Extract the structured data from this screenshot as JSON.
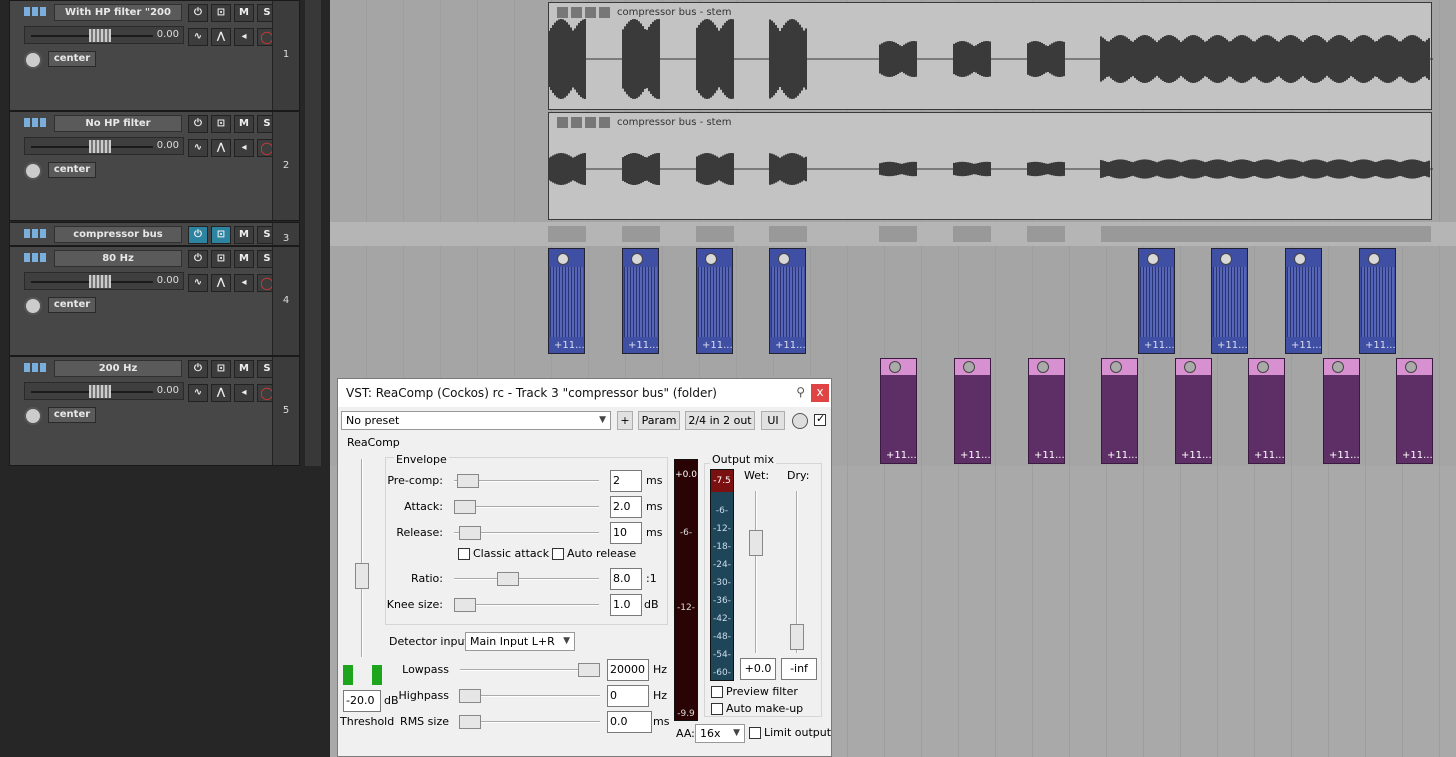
{
  "tracks": [
    {
      "number": "1",
      "name": "With HP filter \"200",
      "volume": "0.00",
      "pan": "center",
      "lit": false
    },
    {
      "number": "2",
      "name": "No HP filter",
      "volume": "0.00",
      "pan": "center",
      "lit": false
    },
    {
      "number": "3",
      "name": "compressor bus",
      "lit": true
    },
    {
      "number": "4",
      "name": "80 Hz",
      "volume": "0.00",
      "pan": "center",
      "lit": false
    },
    {
      "number": "5",
      "name": "200 Hz",
      "volume": "0.00",
      "pan": "center",
      "lit": false
    }
  ],
  "buttons": {
    "mute": "M",
    "solo": "S"
  },
  "items": {
    "stem_title": "compressor bus - stem",
    "block_label": "+11..."
  },
  "fx": {
    "title": "VST: ReaComp (Cockos) rc - Track 3 \"compressor bus\" (folder)",
    "close": "x",
    "preset": "No preset",
    "plus": "+",
    "param": "Param",
    "io": "2/4 in 2 out",
    "ui": "UI",
    "plugin_name": "ReaComp",
    "envelope_label": "Envelope",
    "precomp": {
      "label": "Pre-comp:",
      "value": "2",
      "unit": "ms",
      "slider": 0.05
    },
    "attack": {
      "label": "Attack:",
      "value": "2.0",
      "unit": "ms",
      "slider": 0.03
    },
    "release": {
      "label": "Release:",
      "value": "10",
      "unit": "ms",
      "slider": 0.07
    },
    "classic_attack": "Classic attack",
    "auto_release": "Auto release",
    "ratio": {
      "label": "Ratio:",
      "value": "8.0",
      "unit": ":1",
      "slider": 0.36
    },
    "knee": {
      "label": "Knee size:",
      "value": "1.0",
      "unit": "dB",
      "slider": 0.03
    },
    "detector": {
      "label": "Detector input:",
      "value": "Main Input L+R"
    },
    "lowpass": {
      "label": "Lowpass",
      "value": "20000",
      "unit": "Hz",
      "slider": 0.97
    },
    "highpass": {
      "label": "Highpass",
      "value": "0",
      "unit": "Hz",
      "slider": 0.02
    },
    "rms": {
      "label": "RMS size",
      "value": "0.0",
      "unit": "ms",
      "slider": 0.02
    },
    "threshold": {
      "value": "-20.0",
      "unit": "dB",
      "label": "Threshold",
      "slider": 0.6
    },
    "input_meter": {
      "ticks": [
        "+0.0",
        "-6-",
        "-12-",
        "-9.9"
      ]
    },
    "output_mix": "Output mix",
    "wet": {
      "label": "Wet:",
      "value": "+0.0",
      "slider": 0.3
    },
    "dry": {
      "label": "Dry:",
      "value": "-inf",
      "slider": 0.95
    },
    "gr_meter": {
      "top": "-7.5",
      "ticks": [
        "-6-",
        "-12-",
        "-18-",
        "-24-",
        "-30-",
        "-36-",
        "-42-",
        "-48-",
        "-54-",
        "-60-"
      ]
    },
    "preview_filter": "Preview filter",
    "auto_makeup": "Auto make-up",
    "aa_label": "AA:",
    "aa_value": "16x",
    "limit_output": "Limit output"
  },
  "colors": {
    "accent": "#2d84a0",
    "track4_items": "#3f4fa3",
    "track5_items": "#5e2e66",
    "track5_header": "#d790d0"
  }
}
